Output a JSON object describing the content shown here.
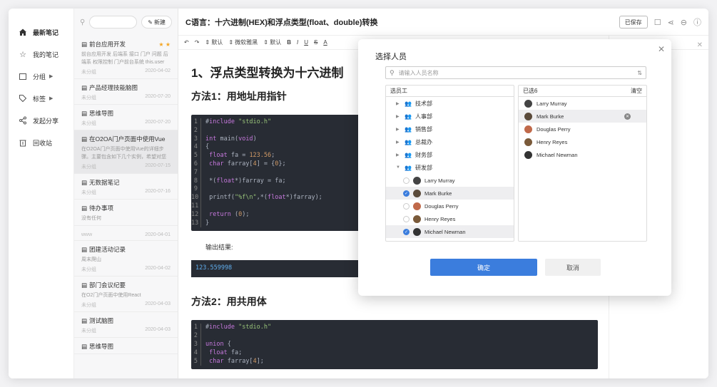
{
  "sidebar": {
    "items": [
      {
        "label": "最新笔记",
        "icon": "home-icon"
      },
      {
        "label": "我的笔记",
        "icon": "star-icon"
      },
      {
        "label": "分组",
        "icon": "folder-icon"
      },
      {
        "label": "标签",
        "icon": "tag-icon"
      },
      {
        "label": "发起分享",
        "icon": "share-icon"
      },
      {
        "label": "回收站",
        "icon": "trash-icon"
      }
    ]
  },
  "notelist": {
    "new_label": "新建",
    "notes": [
      {
        "title": "前台应用开发",
        "snippet": "前台应用开发 后端系 接口 门户 问题 后端系 权限控制 门户前台系统 this.user",
        "meta_left": "未分组",
        "date": "2020-04-02"
      },
      {
        "title": "产品经理技能脑图",
        "snippet": "",
        "meta_left": "未分组",
        "date": "2020-07-20"
      },
      {
        "title": "思维导图",
        "snippet": "",
        "meta_left": "未分组",
        "date": "2020-07-20"
      },
      {
        "title": "在O2OA门户页面中使用Vue",
        "snippet": "在O2OA门户页面中使用Vue的详细步骤。主要包含如下几个实例，希望对您的门户页面开发",
        "meta_left": "未分组",
        "date": "2020-07-15"
      },
      {
        "title": "无数据笔记",
        "snippet": "",
        "meta_left": "未分组",
        "date": "2020-07-16"
      },
      {
        "title": "待办事项",
        "snippet": "没有任何",
        "meta_left": "",
        "date": ""
      },
      {
        "title": "",
        "snippet": "",
        "meta_left": "www",
        "date": "2020-04-01"
      },
      {
        "title": "团建活动记录",
        "snippet": "周末爬山",
        "meta_left": "未分组",
        "date": "2020-04-02"
      },
      {
        "title": "部门会议纪要",
        "snippet": "在O2门户页面中使用React",
        "meta_left": "未分组",
        "date": "2020-04-03"
      },
      {
        "title": "测试脑图",
        "snippet": "",
        "meta_left": "未分组",
        "date": "2020-04-03"
      },
      {
        "title": "思维导图",
        "snippet": "",
        "meta_left": "",
        "date": ""
      }
    ]
  },
  "editor": {
    "title": "C语言：十六进制(HEX)和浮点类型(float、double)转换",
    "saved_label": "已保存",
    "toolbar": [
      "默认",
      "微软雅黑",
      "默认",
      "B",
      "I",
      "U",
      "S",
      "A"
    ],
    "h1": "1、浮点类型转换为十六进制",
    "h2a": "方法1：用地址用指针",
    "code1": [
      "#include \"stdio.h\"",
      "",
      "int main(void)",
      "{",
      " float fa = 123.56;",
      " char farray[4] = {0};",
      "",
      " *(float*)farray = fa;",
      "",
      " printf(\"%f\\n\",*(float*)farray);",
      "",
      " return (0);",
      "}"
    ],
    "output_label": "输出结果:",
    "output": "123.559998",
    "h2b": "方法2：用共用体",
    "code2": [
      "#include \"stdio.h\"",
      "",
      "union {",
      " float fa;",
      " char farray[4];"
    ]
  },
  "modal": {
    "title": "选择人员",
    "search_placeholder": "请输入人员名称",
    "left_header": "选员工",
    "right_header": "已选6",
    "clear_label": "清空",
    "departments": [
      {
        "name": "技术部",
        "expanded": false
      },
      {
        "name": "人事部",
        "expanded": false
      },
      {
        "name": "销售部",
        "expanded": false
      },
      {
        "name": "总裁办",
        "expanded": false
      },
      {
        "name": "财务部",
        "expanded": false
      },
      {
        "name": "研发部",
        "expanded": true
      }
    ],
    "members": [
      {
        "name": "Larry Murray",
        "checked": false,
        "color": "#444444"
      },
      {
        "name": "Mark Burke",
        "checked": true,
        "color": "#5a4a3a"
      },
      {
        "name": "Douglas Perry",
        "checked": false,
        "color": "#c0694a"
      },
      {
        "name": "Henry Reyes",
        "checked": false,
        "color": "#7a5a3a"
      },
      {
        "name": "Michael Newman",
        "checked": true,
        "color": "#333333"
      }
    ],
    "selected": [
      {
        "name": "Larry Murray",
        "color": "#444444"
      },
      {
        "name": "Mark Burke",
        "color": "#5a4a3a"
      },
      {
        "name": "Douglas Perry",
        "color": "#c0694a"
      },
      {
        "name": "Henry Reyes",
        "color": "#7a5a3a"
      },
      {
        "name": "Michael Newman",
        "color": "#333333"
      }
    ],
    "ok_label": "确定",
    "cancel_label": "取消",
    "accent": "#3b7ddd"
  }
}
